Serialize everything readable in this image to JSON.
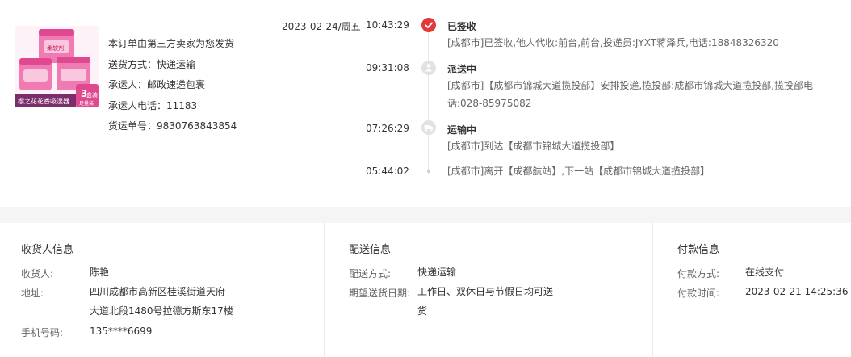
{
  "order_info": {
    "product_image_text": {
      "brand": "柔软剂",
      "banner": "樱之花花香吸湿器",
      "badge_number": "3",
      "badge_text": "盒装",
      "badge_sub": "足量装"
    },
    "lines": [
      "本订单由第三方卖家为您发货",
      "送货方式：快递运输",
      "承运人：邮政速递包裹",
      "承运人电话：11183",
      "货运单号：9830763843854"
    ]
  },
  "timeline": {
    "date": "2023-02-24/周五",
    "entries": [
      {
        "time": "10:43:29",
        "status": "已签收",
        "icon": "check-icon",
        "detail": "[成都市]已签收,他人代收:前台,前台,投递员:JYXT蒋泽兵,电话:18848326320"
      },
      {
        "time": "09:31:08",
        "status": "派送中",
        "icon": "delivery-person-icon",
        "detail": "[成都市]【成都市锦城大道揽投部】安排投递,揽投部:成都市锦城大道揽投部,揽投部电话:028-85975082"
      },
      {
        "time": "07:26:29",
        "status": "运输中",
        "icon": "truck-icon",
        "detail": "[成都市]到达【成都市锦城大道揽投部】"
      },
      {
        "time": "05:44:02",
        "status": "",
        "icon": "dot-icon",
        "detail": "[成都市]离开【成都航站】,下一站【成都市锦城大道揽投部】"
      }
    ]
  },
  "receiver": {
    "title": "收货人信息",
    "name_label": "收货人:",
    "name": "陈艳",
    "address_label": "地址:",
    "address_line1": "四川成都市高新区桂溪街道天府",
    "address_line2": "大道北段1480号拉德方斯东17楼",
    "phone_label": "手机号码:",
    "phone": "135****6699"
  },
  "delivery": {
    "title": "配送信息",
    "method_label": "配送方式:",
    "method": "快递运输",
    "date_label": "期望送货日期:",
    "date_line1": "工作日、双休日与节假日均可送",
    "date_line2": "货"
  },
  "payment": {
    "title": "付款信息",
    "method_label": "付款方式:",
    "method": "在线支付",
    "time_label": "付款时间:",
    "time": "2023-02-21 14:25:36"
  },
  "colors": {
    "accent": "#e4393c",
    "divider": "#ececec",
    "gap": "#f5f5f5"
  }
}
